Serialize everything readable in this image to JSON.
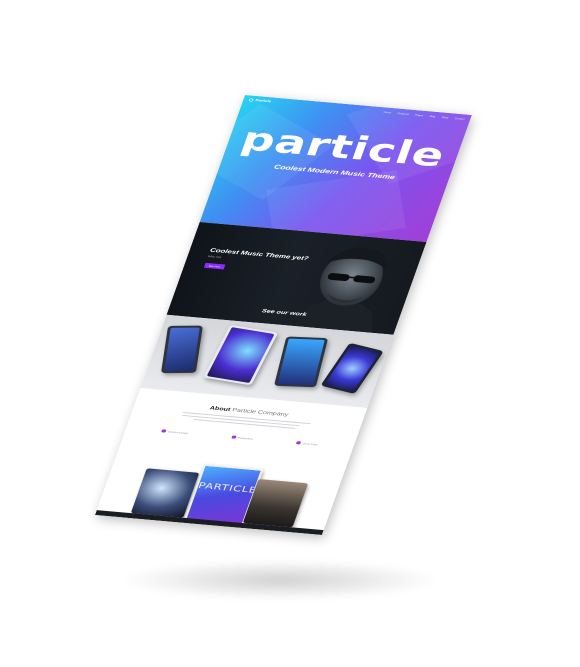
{
  "hero": {
    "logo": "Particle",
    "nav": [
      "Home",
      "Features",
      "Pages",
      "Blog",
      "Shop",
      "Contact"
    ],
    "title": "particle",
    "subtitle": "Coolest Modern Music Theme"
  },
  "promo": {
    "title": "Coolest Music Theme yet?",
    "subtitle": "Why not",
    "button": "Buy Now",
    "section_title": "See our work"
  },
  "about": {
    "title_strong": "About",
    "title_rest": "Particle Company",
    "features": [
      "Creative Design",
      "Responsive",
      "Clean Code"
    ]
  },
  "showcase": {
    "tablet_title": "PARTICLE"
  },
  "colors": {
    "hero_start": "#27d4f2",
    "hero_end": "#a23ed8",
    "accent": "#8b2cff",
    "dark": "#151a20"
  }
}
